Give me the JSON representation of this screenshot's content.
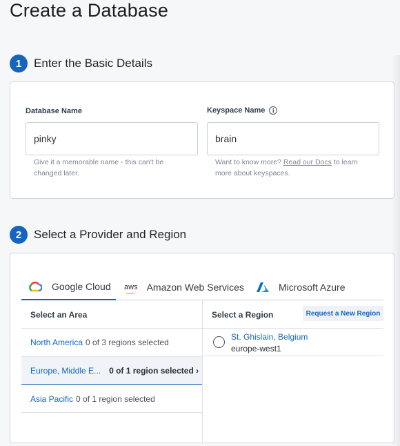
{
  "page": {
    "title": "Create a Database"
  },
  "step1": {
    "number": "1",
    "title": "Enter the Basic Details",
    "database_name": {
      "label": "Database Name",
      "value": "pinky",
      "help": "Give it a memorable name - this can't be changed later."
    },
    "keyspace_name": {
      "label": "Keyspace Name",
      "info_icon": "info-icon",
      "value": "brain",
      "help_prefix": "Want to know more? ",
      "help_link": "Read our Docs",
      "help_suffix": " to learn more about keyspaces."
    }
  },
  "step2": {
    "number": "2",
    "title": "Select a Provider and Region",
    "tabs": [
      {
        "label": "Google Cloud",
        "icon": "google-cloud-icon",
        "active": true
      },
      {
        "label": "Amazon Web Services",
        "icon": "aws-icon",
        "logo_text": "aws",
        "active": false
      },
      {
        "label": "Microsoft Azure",
        "icon": "azure-icon",
        "active": false
      }
    ],
    "area_header": "Select an Area",
    "region_header": "Select a Region",
    "request_button": "Request a New Region",
    "areas": [
      {
        "name": "North America",
        "count": "0 of 3 regions selected"
      },
      {
        "name": "Europe, Middle E...",
        "count": "0 of 1 region selected ›"
      },
      {
        "name": "Asia Pacific",
        "count": "0 of 1 region selected"
      }
    ],
    "regions": [
      {
        "name": "St. Ghislain, Belgium",
        "id": "europe-west1"
      }
    ]
  },
  "colors": {
    "accent": "#1565c0",
    "border": "#d3d7de",
    "background": "#f6f7f9"
  }
}
